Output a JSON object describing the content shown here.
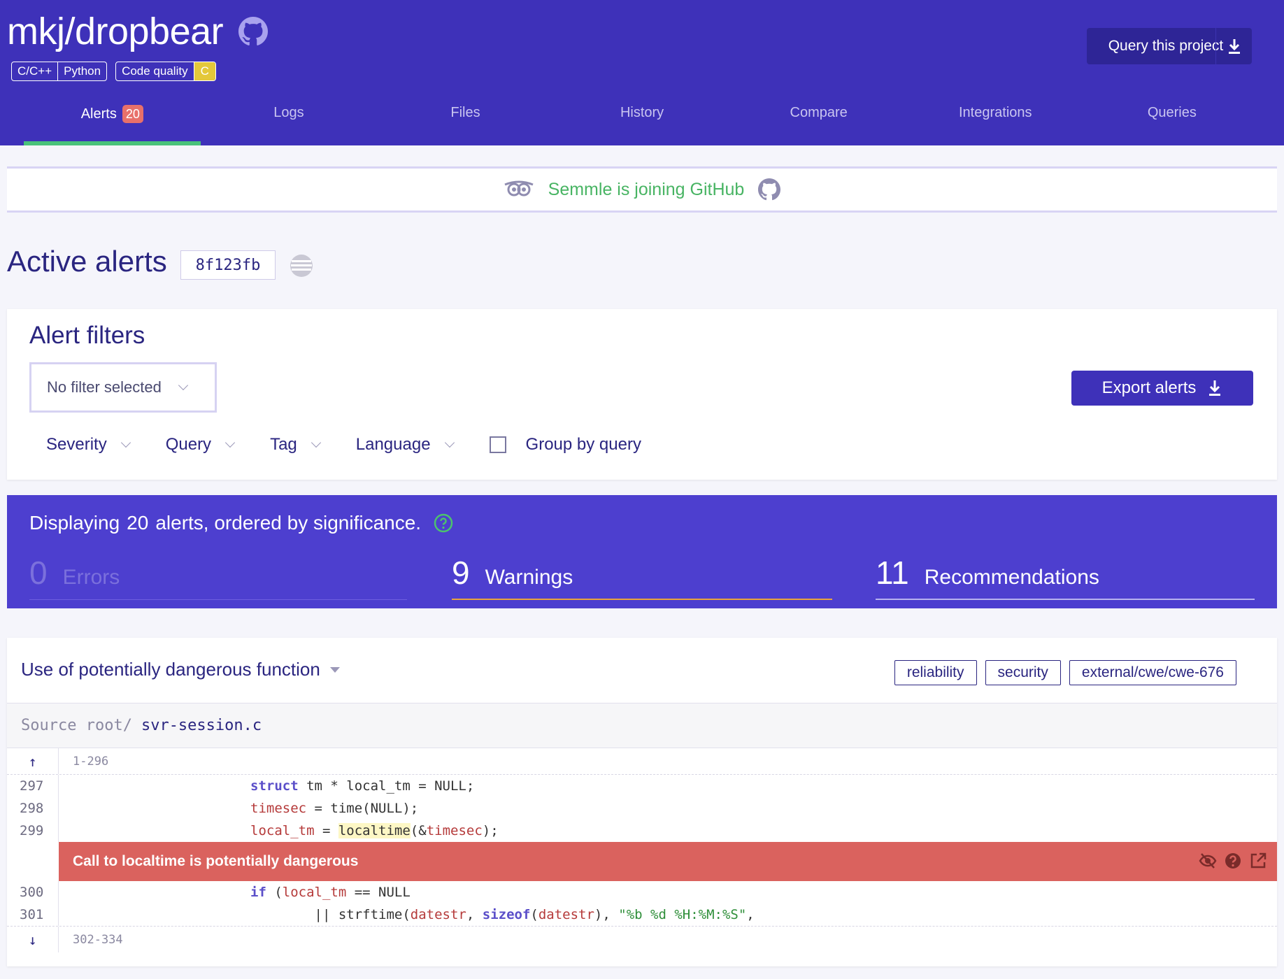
{
  "header": {
    "project_title": "mkj/dropbear",
    "badges": {
      "languages": [
        "C/C++",
        "Python"
      ],
      "quality_label": "Code quality",
      "quality_grade": "C"
    },
    "query_button_label": "Query this project"
  },
  "tabs": [
    {
      "label": "Alerts",
      "count": "20",
      "active": true
    },
    {
      "label": "Logs"
    },
    {
      "label": "Files"
    },
    {
      "label": "History"
    },
    {
      "label": "Compare"
    },
    {
      "label": "Integrations"
    },
    {
      "label": "Queries"
    }
  ],
  "banner": {
    "text": "Semmle is joining GitHub"
  },
  "active_alerts": {
    "title": "Active alerts",
    "commit": "8f123fb"
  },
  "filters": {
    "title": "Alert filters",
    "select_value": "No filter selected",
    "export_label": "Export alerts",
    "dropdowns": [
      "Severity",
      "Query",
      "Tag",
      "Language"
    ],
    "group_by_label": "Group by query"
  },
  "summary": {
    "prefix": "Displaying",
    "count": "20",
    "suffix": "alerts, ordered by significance.",
    "errors": {
      "num": "0",
      "label": "Errors"
    },
    "warnings": {
      "num": "9",
      "label": "Warnings"
    },
    "recommendations": {
      "num": "11",
      "label": "Recommendations"
    }
  },
  "alert": {
    "title": "Use of potentially dangerous function",
    "tags": [
      "reliability",
      "security",
      "external/cwe/cwe-676"
    ],
    "source_prefix": "Source root/",
    "source_file": "svr-session.c",
    "fold_top": "1-296",
    "fold_bottom": "302-334",
    "lines": {
      "l297": "297",
      "l298": "298",
      "l299": "299",
      "l300": "300",
      "l301": "301"
    },
    "message": "Call to localtime is potentially dangerous"
  },
  "colors": {
    "header_bg": "#3e31b9",
    "summary_bg": "#4d3fcf",
    "alert_red": "#da625e",
    "accent_green": "#49c27a",
    "warning_orange": "#e9a33c"
  }
}
